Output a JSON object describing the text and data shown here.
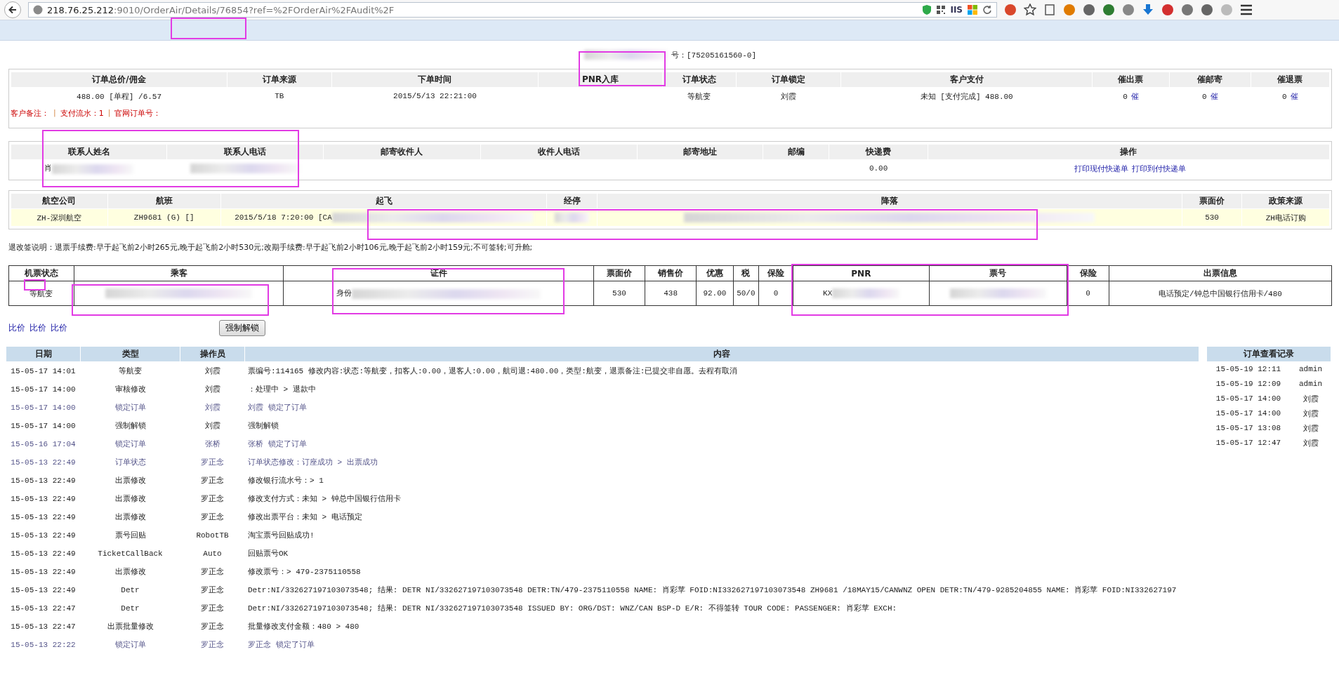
{
  "browser": {
    "url_host": "218.76.25.212",
    "url_path": ":9010/OrderAir/Details/76854?ref=%2FOrderAir%2FAudit%2F",
    "badge": "IIS"
  },
  "order_number": "号：[75205161560-0]",
  "order_table": {
    "columns": [
      "订单总价/佣金",
      "订单来源",
      "下单时间",
      "PNR入库",
      "订单状态",
      "订单锁定",
      "客户支付",
      "催出票",
      "催邮寄",
      "催退票"
    ],
    "row": {
      "total": {
        "text": "488.00 [单程] /6.57"
      },
      "source": {
        "text": "TB"
      },
      "time": {
        "text": "2015/5/13 22:21:00"
      },
      "status": {
        "text": "等航变"
      },
      "lock": {
        "text": "刘霞"
      },
      "payment": {
        "text": "未知 [支付完成] 488.00"
      },
      "urge_ticket": {
        "text": "0",
        "links": [
          "催"
        ]
      },
      "urge_mail": {
        "text": "0",
        "links": [
          "催"
        ]
      },
      "urge_refund": {
        "text": "0",
        "links": [
          "催"
        ]
      }
    },
    "notes": [
      {
        "kind": "note",
        "text": "客户备注："
      },
      {
        "kind": "separator",
        "text": "|"
      },
      {
        "kind": "note",
        "text": "支付流水：1"
      },
      {
        "kind": "separator",
        "text": "|"
      },
      {
        "kind": "note",
        "text": "官网订单号："
      }
    ]
  },
  "contact_table": {
    "columns": [
      "联系人姓名",
      "联系人电话",
      "邮寄收件人",
      "收件人电话",
      "邮寄地址",
      "邮编",
      "快递费",
      "操作"
    ],
    "row": {
      "name": {
        "text": "肖",
        "redacted": true
      },
      "phone": {
        "redacted": true
      },
      "fee": {
        "text": "0.00"
      },
      "actions": {
        "links": [
          "打印现付快递单",
          "打印到付快递单"
        ]
      }
    }
  },
  "flight_table": {
    "columns": [
      "航空公司",
      "航班",
      "起飞",
      "经停",
      "降落",
      "票面价",
      "政策来源"
    ],
    "row": {
      "airline": {
        "text": "ZH-深圳航空"
      },
      "flight": {
        "text": "ZH9681 (G) []"
      },
      "departure": {
        "text": "2015/5/18 7:20:00 [CA",
        "redacted": true
      },
      "stop": {
        "redacted": true
      },
      "arrival": {
        "redacted": true
      },
      "fare": {
        "text": "530"
      },
      "policy": {
        "text": "ZH电话订购"
      }
    }
  },
  "refund_note": "退改签说明：退票手续费:早于起飞前2小时265元,晚于起飞前2小时530元;改期手续费:早于起飞前2小时106元,晚于起飞前2小时159元;不可签转;可升舱;",
  "passenger_table": {
    "columns": [
      "机票状态",
      "乘客",
      "证件",
      "票面价",
      "销售价",
      "优惠",
      "税",
      "保险",
      "PNR",
      "票号",
      "保险",
      "出票信息"
    ],
    "row": {
      "status": {
        "text": "等航变"
      },
      "passenger": {
        "redacted": true
      },
      "id": {
        "text": "身份",
        "redacted": true
      },
      "fare": {
        "text": "530"
      },
      "sale": {
        "text": "438"
      },
      "discount": {
        "text": "92.00"
      },
      "tax": {
        "text": "50/0"
      },
      "insurance": {
        "text": "0"
      },
      "pnr": {
        "text": "KX",
        "redacted": true
      },
      "ticket": {
        "redacted": true
      },
      "insurance2": {
        "text": "0"
      },
      "issue": {
        "text": "电话预定/钟总中国银行信用卡/480"
      }
    }
  },
  "compare_links": [
    "比价",
    "比价",
    "比价"
  ],
  "unlock_button": "强制解锁",
  "log": {
    "columns": [
      "日期",
      "类型",
      "操作员",
      "内容"
    ],
    "rows": [
      {
        "kind": "normal",
        "date": "15-05-17 14:01",
        "type": "等航变",
        "operator": "刘霞",
        "content": "票编号:114165 修改内容:状态:等航变，扣客人:0.00，退客人:0.00，航司退:480.00，类型:航变，退票备注:已提交非自愿。去程有取消"
      },
      {
        "kind": "normal",
        "date": "15-05-17 14:00",
        "type": "审核修改",
        "operator": "刘霞",
        "content": "：处理中 > 退款中"
      },
      {
        "kind": "lock",
        "date": "15-05-17 14:00",
        "type": "锁定订单",
        "operator": "刘霞",
        "content": "刘霞 锁定了订单"
      },
      {
        "kind": "normal",
        "date": "15-05-17 14:00",
        "type": "强制解锁",
        "operator": "刘霞",
        "content": "强制解锁"
      },
      {
        "kind": "lock",
        "date": "15-05-16 17:04",
        "type": "锁定订单",
        "operator": "张桥",
        "content": "张桥 锁定了订单"
      },
      {
        "kind": "lock",
        "date": "15-05-13 22:49",
        "type": "订单状态",
        "operator": "罗正念",
        "content": "订单状态修改：订座成功 > 出票成功"
      },
      {
        "kind": "normal",
        "date": "15-05-13 22:49",
        "type": "出票修改",
        "operator": "罗正念",
        "content": "修改银行流水号：> 1"
      },
      {
        "kind": "normal",
        "date": "15-05-13 22:49",
        "type": "出票修改",
        "operator": "罗正念",
        "content": "修改支付方式：未知 > 钟总中国银行信用卡"
      },
      {
        "kind": "normal",
        "date": "15-05-13 22:49",
        "type": "出票修改",
        "operator": "罗正念",
        "content": "修改出票平台：未知 > 电话预定"
      },
      {
        "kind": "normal",
        "date": "15-05-13 22:49",
        "type": "票号回贴",
        "operator": "RobotTB",
        "content": "淘宝票号回贴成功!"
      },
      {
        "kind": "normal",
        "date": "15-05-13 22:49",
        "type": "TicketCallBack",
        "operator": "Auto",
        "content": "回贴票号OK"
      },
      {
        "kind": "normal",
        "date": "15-05-13 22:49",
        "type": "出票修改",
        "operator": "罗正念",
        "content": "修改票号：> 479-2375110558"
      },
      {
        "kind": "normal",
        "date": "15-05-13 22:49",
        "type": "Detr",
        "operator": "罗正念",
        "content": "Detr:NI/332627197103073548; 结果: DETR NI/332627197103073548 DETR:TN/479-2375110558 NAME: 肖彩苹 FOID:NI332627197103073548 ZH9681 /18MAY15/CANWNZ OPEN DETR:TN/479-9285204855 NAME: 肖彩苹 FOID:NI332627197"
      },
      {
        "kind": "normal",
        "date": "15-05-13 22:47",
        "type": "Detr",
        "operator": "罗正念",
        "content": "Detr:NI/332627197103073548; 结果: DETR NI/332627197103073548 ISSUED BY: ORG/DST: WNZ/CAN BSP-D E/R: 不得签转 TOUR CODE: PASSENGER: 肖彩苹 EXCH:"
      },
      {
        "kind": "normal",
        "date": "15-05-13 22:47",
        "type": "出票批量修改",
        "operator": "罗正念",
        "content": "批量修改支付金额：480 > 480"
      },
      {
        "kind": "lock",
        "date": "15-05-13 22:22",
        "type": "锁定订单",
        "operator": "罗正念",
        "content": "罗正念 锁定了订单"
      }
    ]
  },
  "views": {
    "title": "订单查看记录",
    "rows": [
      {
        "time": "15-05-19 12:11",
        "user": "admin"
      },
      {
        "time": "15-05-19 12:09",
        "user": "admin"
      },
      {
        "time": "15-05-17 14:00",
        "user": "刘霞"
      },
      {
        "time": "15-05-17 14:00",
        "user": "刘霞"
      },
      {
        "time": "15-05-17 13:08",
        "user": "刘霞"
      },
      {
        "time": "15-05-17 12:47",
        "user": "刘霞"
      }
    ]
  }
}
